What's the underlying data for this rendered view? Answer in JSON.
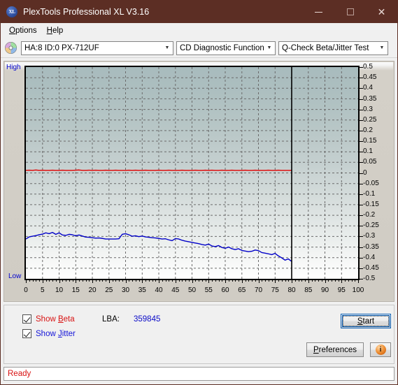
{
  "window": {
    "title": "PlexTools Professional XL V3.16",
    "app_icon": "xl-logo-icon",
    "minimize_label": "–",
    "maximize_label": "□",
    "close_label": "✕"
  },
  "menubar": {
    "items": [
      {
        "label": "Options"
      },
      {
        "label": "Help"
      }
    ]
  },
  "toolbar": {
    "drive_icon": "disc-icon",
    "drive_combo": {
      "value": "HA:8 ID:0  PX-712UF",
      "arrow": "⌄"
    },
    "function_combo": {
      "value": "CD Diagnostic Functions",
      "arrow": "⌄"
    },
    "test_combo": {
      "value": "Q-Check Beta/Jitter Test",
      "arrow": "⌄"
    }
  },
  "chart_data": {
    "type": "line",
    "title": "Q-Check Beta/Jitter Test",
    "xlabel": "",
    "ylabel": "",
    "high_label": "High",
    "low_label": "Low",
    "xlim": [
      0,
      100
    ],
    "ylim": [
      -0.5,
      0.5
    ],
    "grid": true,
    "legend_position": "none",
    "xticks": [
      0,
      5,
      10,
      15,
      20,
      25,
      30,
      35,
      40,
      45,
      50,
      55,
      60,
      65,
      70,
      75,
      80,
      85,
      90,
      95,
      100
    ],
    "yticks": [
      0.5,
      0.45,
      0.4,
      0.35,
      0.3,
      0.25,
      0.2,
      0.15,
      0.1,
      0.05,
      0,
      -0.05,
      -0.1,
      -0.15,
      -0.2,
      -0.25,
      -0.3,
      -0.35,
      -0.4,
      -0.45,
      -0.5
    ],
    "marker_line_x": 80,
    "marker_line_color": "#000000",
    "series": [
      {
        "name": "Beta",
        "color": "#e00000",
        "x": [
          0,
          1,
          2,
          3,
          4,
          5,
          6,
          7,
          8,
          9,
          10,
          11,
          12,
          13,
          14,
          15,
          16,
          17,
          18,
          19,
          20,
          21,
          22,
          23,
          24,
          25,
          26,
          27,
          28,
          29,
          30,
          31,
          32,
          33,
          34,
          35,
          36,
          37,
          38,
          39,
          40,
          41,
          42,
          43,
          44,
          45,
          46,
          47,
          48,
          49,
          50,
          51,
          52,
          53,
          54,
          55,
          56,
          57,
          58,
          59,
          60,
          61,
          62,
          63,
          64,
          65,
          66,
          67,
          68,
          69,
          70,
          71,
          72,
          73,
          74,
          75,
          76,
          77,
          78,
          79,
          80
        ],
        "y": [
          0.012,
          0.013,
          0.012,
          0.014,
          0.012,
          0.013,
          0.012,
          0.012,
          0.013,
          0.012,
          0.012,
          0.013,
          0.012,
          0.012,
          0.012,
          0.013,
          0.014,
          0.012,
          0.012,
          0.013,
          0.012,
          0.013,
          0.012,
          0.012,
          0.013,
          0.012,
          0.012,
          0.013,
          0.012,
          0.012,
          0.012,
          0.013,
          0.012,
          0.013,
          0.012,
          0.012,
          0.013,
          0.012,
          0.012,
          0.012,
          0.013,
          0.012,
          0.012,
          0.013,
          0.012,
          0.012,
          0.012,
          0.013,
          0.012,
          0.012,
          0.012,
          0.013,
          0.012,
          0.012,
          0.013,
          0.012,
          0.013,
          0.012,
          0.012,
          0.013,
          0.012,
          0.012,
          0.013,
          0.012,
          0.012,
          0.012,
          0.013,
          0.012,
          0.012,
          0.013,
          0.012,
          0.012,
          0.012,
          0.013,
          0.012,
          0.012,
          0.013,
          0.012,
          0.012,
          0.012,
          0.012
        ]
      },
      {
        "name": "Jitter",
        "color": "#0000c8",
        "x": [
          0,
          1,
          2,
          3,
          4,
          5,
          6,
          7,
          8,
          9,
          10,
          11,
          12,
          13,
          14,
          15,
          16,
          17,
          18,
          19,
          20,
          21,
          22,
          23,
          24,
          25,
          26,
          27,
          28,
          29,
          30,
          31,
          32,
          33,
          34,
          35,
          36,
          37,
          38,
          39,
          40,
          41,
          42,
          43,
          44,
          45,
          46,
          47,
          48,
          49,
          50,
          51,
          52,
          53,
          54,
          55,
          56,
          57,
          58,
          59,
          60,
          61,
          62,
          63,
          64,
          65,
          66,
          67,
          68,
          69,
          70,
          71,
          72,
          73,
          74,
          75,
          76,
          77,
          78,
          79,
          80
        ],
        "y": [
          -0.312,
          -0.302,
          -0.299,
          -0.296,
          -0.292,
          -0.289,
          -0.283,
          -0.287,
          -0.281,
          -0.29,
          -0.283,
          -0.293,
          -0.295,
          -0.29,
          -0.292,
          -0.297,
          -0.293,
          -0.298,
          -0.303,
          -0.304,
          -0.306,
          -0.308,
          -0.307,
          -0.309,
          -0.312,
          -0.312,
          -0.312,
          -0.312,
          -0.311,
          -0.29,
          -0.287,
          -0.292,
          -0.299,
          -0.297,
          -0.301,
          -0.298,
          -0.302,
          -0.304,
          -0.306,
          -0.307,
          -0.309,
          -0.312,
          -0.311,
          -0.316,
          -0.32,
          -0.31,
          -0.312,
          -0.318,
          -0.322,
          -0.325,
          -0.328,
          -0.331,
          -0.334,
          -0.338,
          -0.341,
          -0.336,
          -0.345,
          -0.348,
          -0.343,
          -0.352,
          -0.356,
          -0.35,
          -0.358,
          -0.362,
          -0.358,
          -0.366,
          -0.369,
          -0.372,
          -0.37,
          -0.364,
          -0.367,
          -0.376,
          -0.379,
          -0.382,
          -0.386,
          -0.38,
          -0.392,
          -0.401,
          -0.412,
          -0.406,
          -0.418,
          -0.423,
          -0.428,
          -0.425,
          -0.427,
          -0.426
        ]
      }
    ]
  },
  "controls": {
    "show_beta": {
      "label": "Show Beta",
      "checked": true,
      "accel": "B"
    },
    "show_jitter": {
      "label": "Show Jitter",
      "checked": true,
      "accel": "J"
    },
    "lba_label": "LBA:",
    "lba_value": "359845",
    "start_button": "Start",
    "preferences_button": "Preferences",
    "info_button_icon": "info-icon"
  },
  "statusbar": {
    "text": "Ready"
  }
}
